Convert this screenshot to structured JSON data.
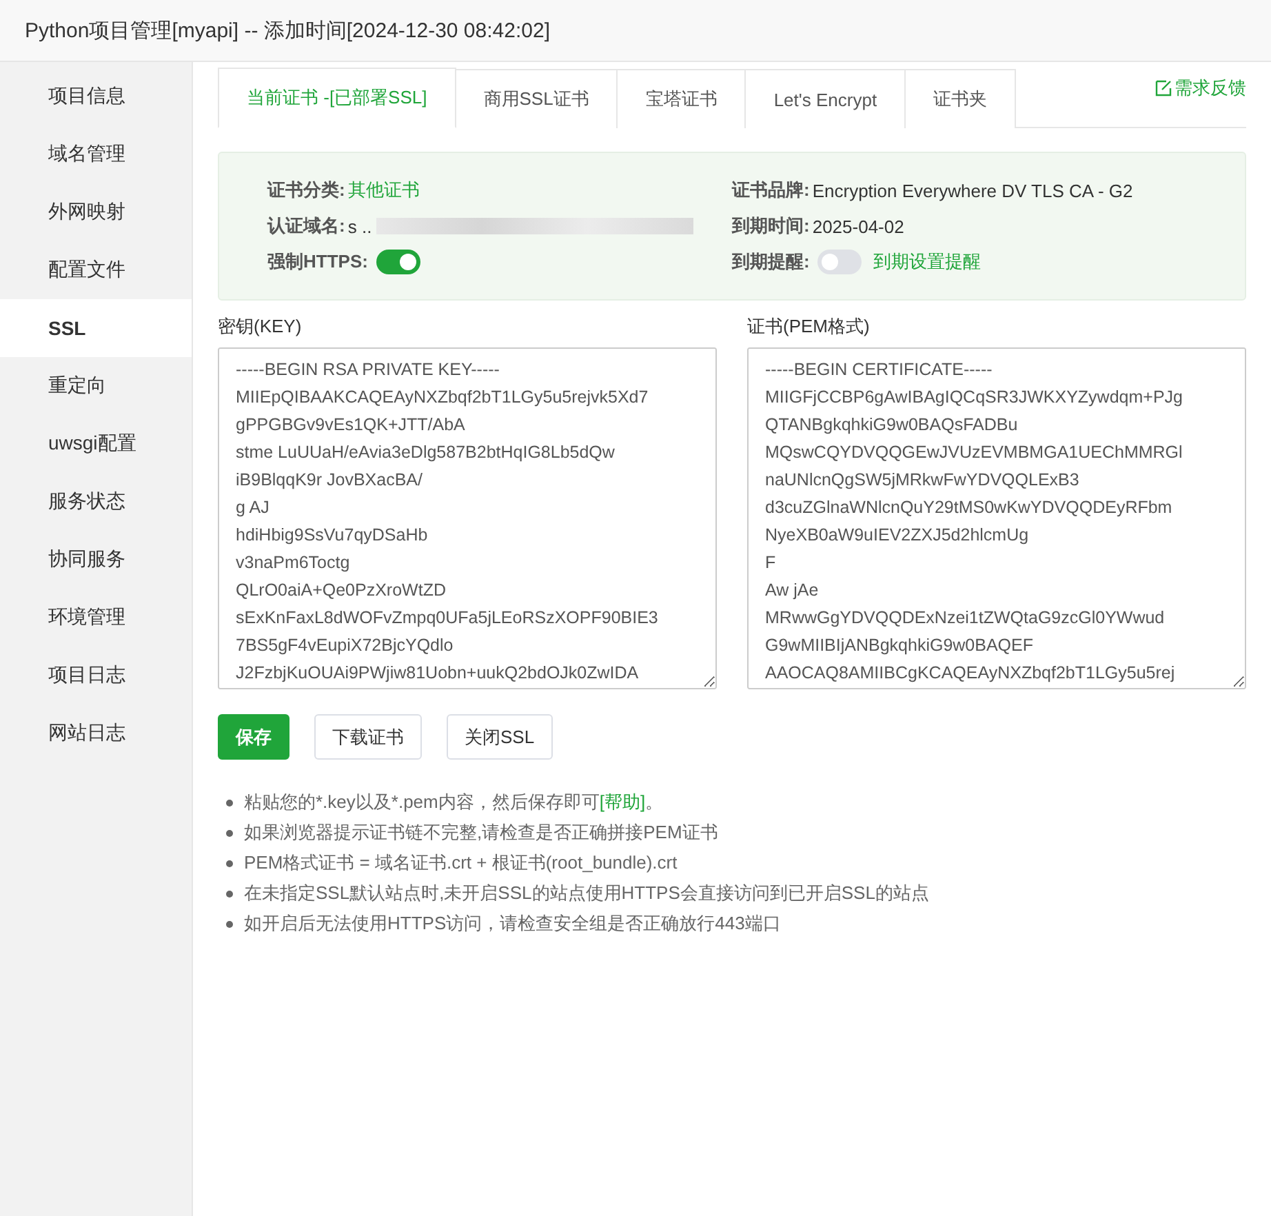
{
  "window": {
    "title": "Python项目管理[myapi] -- 添加时间[2024-12-30 08:42:02]"
  },
  "sidebar": {
    "items": [
      {
        "label": "项目信息",
        "selected": false
      },
      {
        "label": "域名管理",
        "selected": false
      },
      {
        "label": "外网映射",
        "selected": false
      },
      {
        "label": "配置文件",
        "selected": false
      },
      {
        "label": "SSL",
        "selected": true
      },
      {
        "label": "重定向",
        "selected": false
      },
      {
        "label": "uwsgi配置",
        "selected": false
      },
      {
        "label": "服务状态",
        "selected": false
      },
      {
        "label": "协同服务",
        "selected": false
      },
      {
        "label": "环境管理",
        "selected": false
      },
      {
        "label": "项目日志",
        "selected": false
      },
      {
        "label": "网站日志",
        "selected": false
      }
    ]
  },
  "tabs": [
    {
      "label": "当前证书 -[已部署SSL]",
      "selected": true
    },
    {
      "label": "商用SSL证书",
      "selected": false
    },
    {
      "label": "宝塔证书",
      "selected": false
    },
    {
      "label": "Let's Encrypt",
      "selected": false
    },
    {
      "label": "证书夹",
      "selected": false
    }
  ],
  "feedback_link": "需求反馈",
  "cert_info": {
    "category_label": "证书分类:",
    "category": "其他证书",
    "brand_label": "证书品牌:",
    "brand": "Encryption Everywhere DV TLS CA - G2",
    "domain_label": "认证域名:",
    "domain": "s ..",
    "expiry_label": "到期时间:",
    "expiry": "2025-04-02",
    "force_https_label": "强制HTTPS:",
    "force_https_on": true,
    "reminder_label": "到期提醒:",
    "reminder_on": false,
    "reminder_link": "到期设置提醒"
  },
  "key_field": {
    "label": "密钥(KEY)",
    "lines": [
      "-----BEGIN RSA PRIVATE KEY-----",
      "MIIEpQIBAAKCAQEAyNXZbqf2bT1LGy5u5rejvk5Xd7",
      "gPPGBGv9vEs1QK+JTT/AbA",
      "stme LuUUaH/eAvia3eDlg587B2btHqIG8Lb5dQw",
      "iB9BlqqK9r JovBXacBA/",
      "g AJ",
      "hdiHbig9SsVu7qyDSaHb",
      "v3naPm6Toctg",
      "QLrO0aiA+Qe0PzXroWtZD",
      "sExKnFaxL8dWOFvZmpq0UFa5jLEoRSzXOPF90BIE3",
      "7BS5gF4vEupiX72BjcYQdlo",
      "J2FzbjKuOUAi9PWjiw81Uobn+uukQ2bdOJk0ZwIDA"
    ]
  },
  "cert_field": {
    "label": "证书(PEM格式)",
    "lines": [
      "-----BEGIN CERTIFICATE-----",
      "MIIGFjCCBP6gAwIBAgIQCqSR3JWKXYZywdqm+PJg",
      "QTANBgkqhkiG9w0BAQsFADBu",
      "MQswCQYDVQQGEwJVUzEVMBMGA1UEChMMRGl",
      "naUNlcnQgSW5jMRkwFwYDVQQLExB3",
      "d3cuZGlnaWNlcnQuY29tMS0wKwYDVQQDEyRFbm",
      "NyeXB0aW9uIEV2ZXJ5d2hlcmUg",
      "F",
      "Aw jAe",
      "MRwwGgYDVQQDExNzei1tZWQtaG9zcGl0YWwud",
      "G9wMIIBIjANBgkqhkiG9w0BAQEF",
      "AAOCAQ8AMIIBCgKCAQEAyNXZbqf2bT1LGy5u5rej"
    ]
  },
  "buttons": [
    {
      "label": "保存",
      "kind": "primary"
    },
    {
      "label": "下载证书",
      "kind": "default"
    },
    {
      "label": "关闭SSL",
      "kind": "default"
    }
  ],
  "notes": [
    {
      "text": "粘贴您的*.key以及*.pem内容，然后保存即可",
      "link": "[帮助]",
      "after": "。"
    },
    {
      "text": "如果浏览器提示证书链不完整,请检查是否正确拼接PEM证书"
    },
    {
      "text": "PEM格式证书 = 域名证书.crt + 根证书(root_bundle).crt"
    },
    {
      "text": "在未指定SSL默认站点时,未开启SSL的站点使用HTTPS会直接访问到已开启SSL的站点"
    },
    {
      "text": "如开启后无法使用HTTPS访问，请检查安全组是否正确放行443端口"
    }
  ]
}
